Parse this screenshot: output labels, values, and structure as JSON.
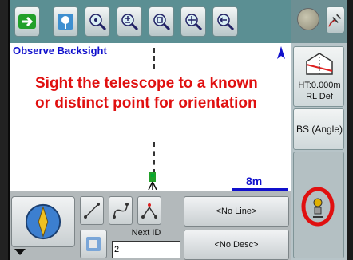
{
  "toolbar": {
    "buttons": [
      {
        "name": "exit",
        "icon": "arrow-right-icon"
      },
      {
        "name": "measure",
        "icon": "survey-point-icon"
      },
      {
        "name": "zoom-point",
        "icon": "zoom-point-icon"
      },
      {
        "name": "zoom-in-out",
        "icon": "zoom-in-out-icon"
      },
      {
        "name": "zoom-window",
        "icon": "zoom-window-icon"
      },
      {
        "name": "pan",
        "icon": "pan-icon"
      },
      {
        "name": "back",
        "icon": "back-arrow-icon"
      }
    ],
    "colors": {
      "bar": "#5b8f93",
      "accent_green": "#22a02a"
    }
  },
  "map": {
    "title": "Observe Backsight",
    "message": "Sight the telescope to a known or distinct point for orientation",
    "scale": "8m"
  },
  "side": {
    "height_label": "HT:0.000m",
    "rl_label": "RL Def",
    "bs_button": "BS (Angle)"
  },
  "bottom": {
    "line_button": "<No Line>",
    "desc_button": "<No Desc>",
    "next_id_label": "Next ID",
    "next_id_value": "2"
  }
}
